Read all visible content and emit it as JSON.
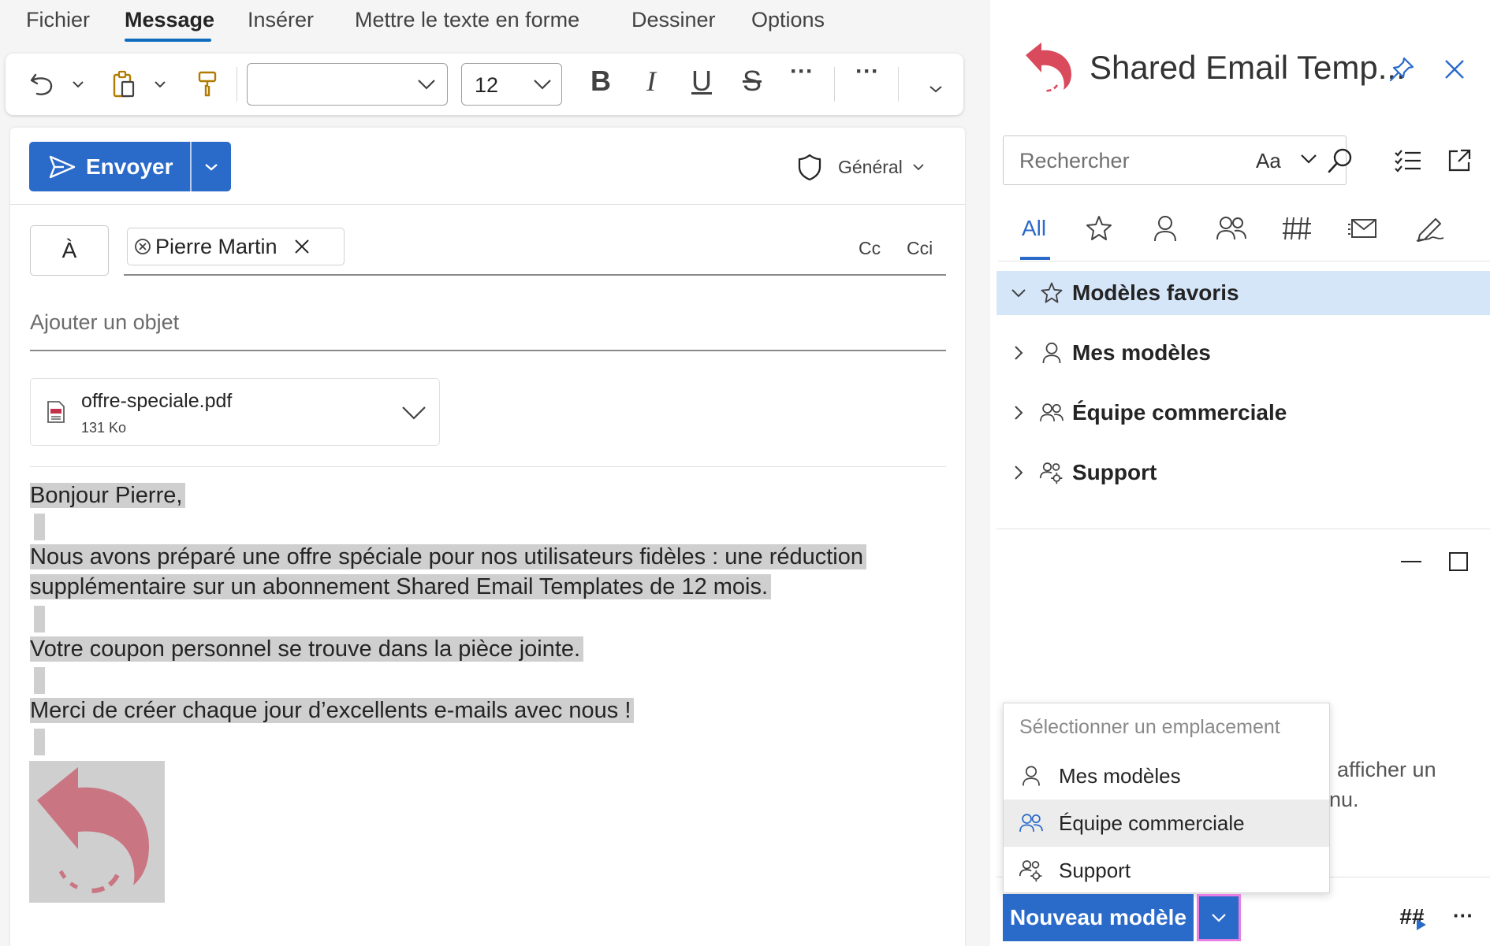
{
  "menu": {
    "tabs": [
      {
        "label": "Fichier"
      },
      {
        "label": "Message"
      },
      {
        "label": "Insérer"
      },
      {
        "label": "Mettre le texte en forme"
      },
      {
        "label": "Dessiner"
      },
      {
        "label": "Options"
      }
    ],
    "active": "Message"
  },
  "toolbar": {
    "font_name": "",
    "font_size": "12",
    "bold": "B",
    "italic": "I",
    "underline": "U",
    "strike": "S",
    "more": "···"
  },
  "compose": {
    "send_label": "Envoyer",
    "sensitivity": "Général",
    "to_label": "À",
    "recipient": "Pierre Martin",
    "cc_label": "Cc",
    "bcc_label": "Cci",
    "subject_placeholder": "Ajouter un objet",
    "attachment": {
      "name": "offre-speciale.pdf",
      "size": "131 Ko"
    },
    "body": {
      "greeting": "Bonjour Pierre,",
      "para1_line1": "Nous avons préparé une offre spéciale pour nos utilisateurs fidèles : une réduction",
      "para1_line2": "supplémentaire sur un abonnement Shared Email Templates de 12 mois.",
      "para2": "Votre coupon personnel se trouve dans la pièce jointe.",
      "para3": "Merci de créer chaque jour d’excellents e-mails avec nous !"
    }
  },
  "pane": {
    "title": "Shared Email Temp...",
    "search_placeholder": "Rechercher",
    "match_case": "Aa",
    "tab_all": "All",
    "tree": [
      {
        "label": "Modèles favoris",
        "icon": "star-icon",
        "expanded": true
      },
      {
        "label": "Mes modèles",
        "icon": "person-icon",
        "expanded": false
      },
      {
        "label": "Équipe commerciale",
        "icon": "people-icon",
        "expanded": false
      },
      {
        "label": "Support",
        "icon": "people-settings-icon",
        "expanded": false
      }
    ],
    "hint_line1": "afficher un",
    "hint_line2": "nu.",
    "new_template": "Nouveau modèle",
    "hash": "##",
    "more": "···",
    "dropdown": {
      "header": "Sélectionner un emplacement",
      "items": [
        {
          "label": "Mes modèles",
          "icon": "person-icon"
        },
        {
          "label": "Équipe commerciale",
          "icon": "people-icon"
        },
        {
          "label": "Support",
          "icon": "people-settings-icon"
        }
      ]
    }
  },
  "colors": {
    "accent": "#2a6ac9",
    "logo": "#d94a5c",
    "selected_row": "#d6e6f9",
    "highlight": "#cfcfcf"
  }
}
